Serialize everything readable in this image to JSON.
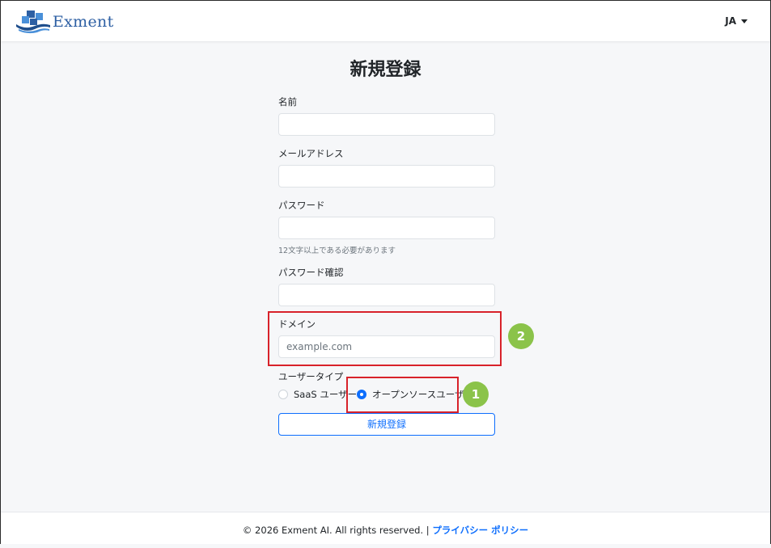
{
  "navbar": {
    "brand_name": "Exment",
    "language": "JA"
  },
  "page": {
    "title": "新規登録"
  },
  "form": {
    "name_label": "名前",
    "name_value": "",
    "email_label": "メールアドレス",
    "email_value": "",
    "password_label": "パスワード",
    "password_value": "",
    "password_help": "12文字以上である必要があります",
    "password_confirm_label": "パスワード確認",
    "password_confirm_value": "",
    "domain_label": "ドメイン",
    "domain_placeholder": "example.com",
    "user_type_label": "ユーザータイプ",
    "user_type_options": [
      {
        "label": "SaaS ユーザー",
        "checked": false
      },
      {
        "label": "オープンソースユーザー",
        "checked": true
      }
    ],
    "submit_label": "新規登録"
  },
  "annotations": {
    "badge_1": "1",
    "badge_2": "2",
    "highlight_color": "#d8222a",
    "badge_color": "#8bc34a"
  },
  "footer": {
    "copyright": "© 2026 Exment AI. All rights reserved. | ",
    "privacy_link": "プライバシー ポリシー"
  },
  "colors": {
    "accent": "#0d6efd",
    "brand": "#2d5fa3"
  }
}
